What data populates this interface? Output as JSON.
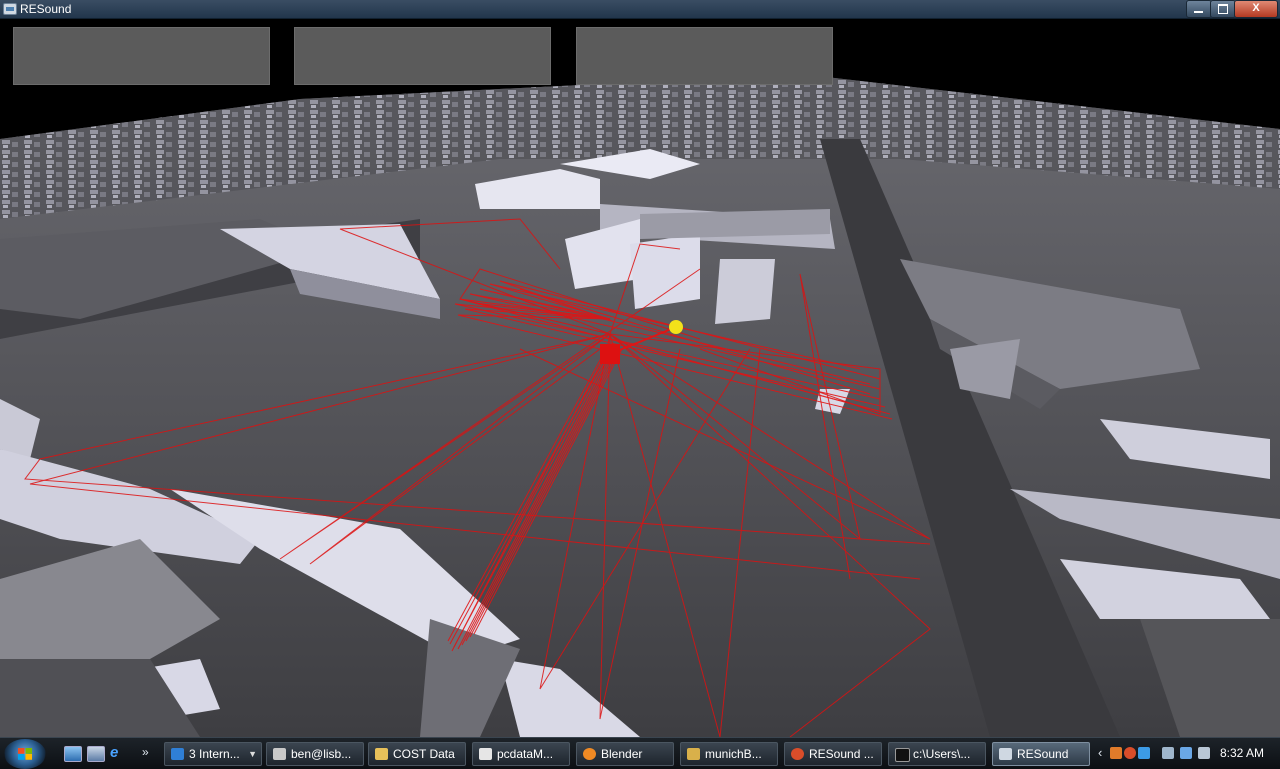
{
  "window": {
    "title": "RESound",
    "controls": {
      "minimize": "",
      "maximize": "",
      "close": "X"
    }
  },
  "viewport": {
    "overlay_panels": [
      "",
      "",
      ""
    ],
    "colors": {
      "rays": "#dd1111",
      "source": "#dd1111",
      "receiver": "#f2e21a",
      "ground": "#4a4a4d",
      "building_lit": "#d8d8e6"
    }
  },
  "taskbar": {
    "quick_launch": {
      "more": "»"
    },
    "tasks": [
      {
        "label": "3 Intern...",
        "icon": "ie-icon"
      },
      {
        "label": "ben@lisb...",
        "icon": "putty-icon"
      },
      {
        "label": "COST Data",
        "icon": "folder-icon"
      },
      {
        "label": "pcdataM...",
        "icon": "document-icon"
      },
      {
        "label": "Blender",
        "icon": "blender-icon"
      },
      {
        "label": "munichB...",
        "icon": "editor-icon"
      },
      {
        "label": "RESound ...",
        "icon": "resound-icon"
      },
      {
        "label": "c:\\Users\\...",
        "icon": "cmd-icon"
      },
      {
        "label": "RESound",
        "icon": "resound-window-icon"
      }
    ],
    "tray": {
      "expand": "‹",
      "clock": "8:32 AM"
    }
  }
}
